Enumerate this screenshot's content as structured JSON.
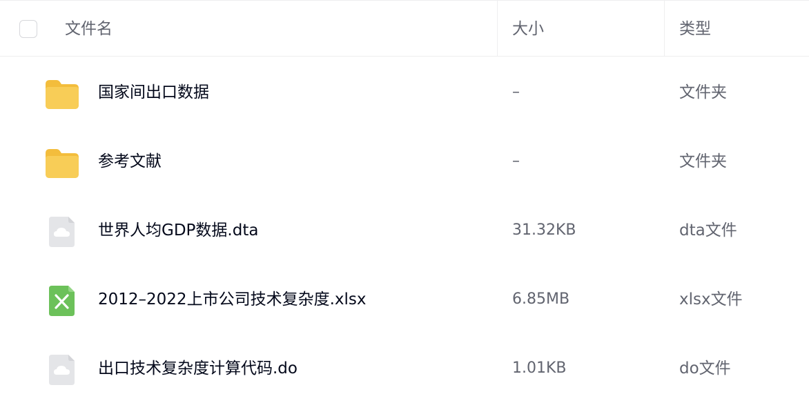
{
  "header": {
    "name_label": "文件名",
    "size_label": "大小",
    "type_label": "类型"
  },
  "files": [
    {
      "name": "国家间出口数据",
      "size": "–",
      "type": "文件夹",
      "icon": "folder-icon"
    },
    {
      "name": "参考文献",
      "size": "–",
      "type": "文件夹",
      "icon": "folder-icon"
    },
    {
      "name": "世界人均GDP数据.dta",
      "size": "31.32KB",
      "type": "dta文件",
      "icon": "cloud-file-icon"
    },
    {
      "name": "2012–2022上市公司技术复杂度.xlsx",
      "size": "6.85MB",
      "type": "xlsx文件",
      "icon": "excel-file-icon"
    },
    {
      "name": "出口技术复杂度计算代码.do",
      "size": "1.01KB",
      "type": "do文件",
      "icon": "cloud-file-icon"
    }
  ],
  "colors": {
    "folder": "#f8cd57",
    "excel": "#6cc15a",
    "generic_file": "#e4e5e8"
  }
}
